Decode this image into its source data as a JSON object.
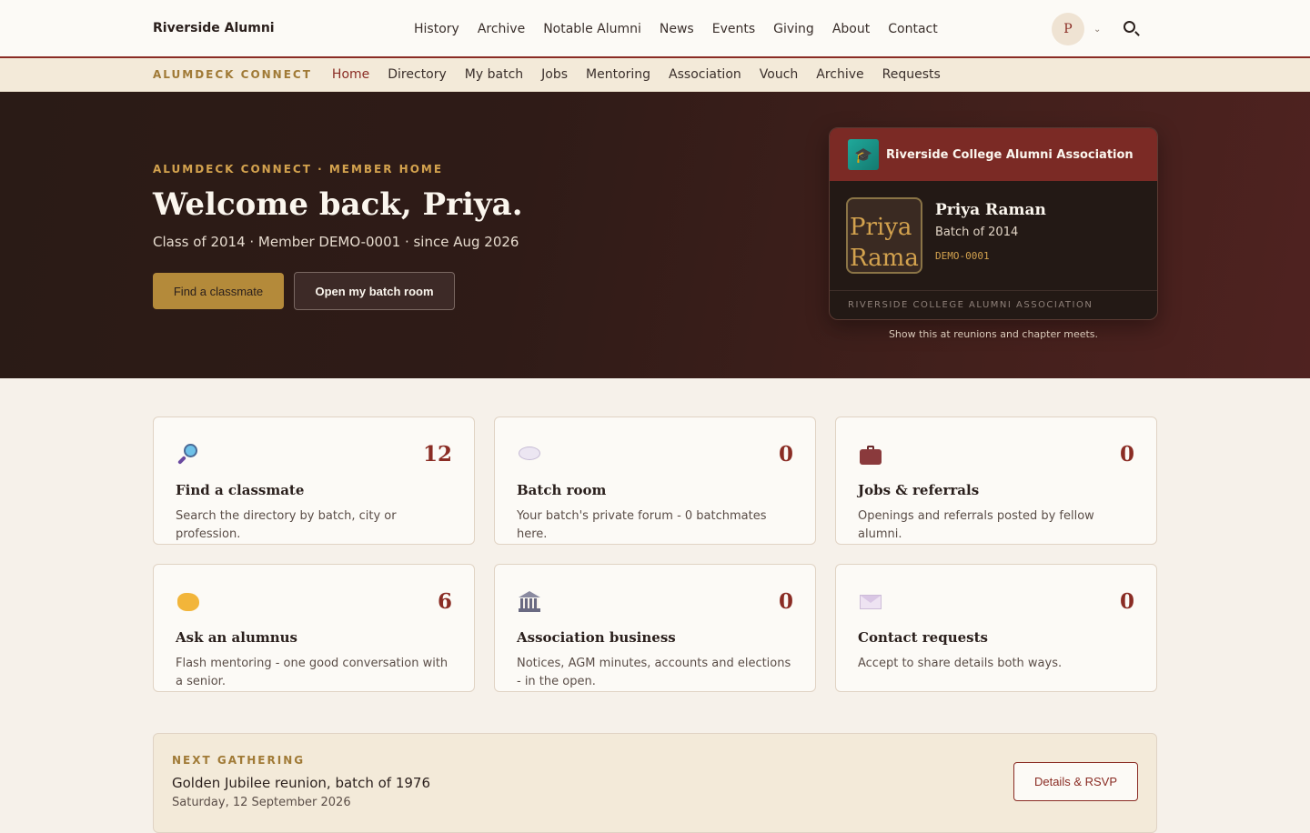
{
  "header": {
    "brand": "Riverside Alumni",
    "nav": [
      "History",
      "Archive",
      "Notable Alumni",
      "News",
      "Events",
      "Giving",
      "About",
      "Contact"
    ],
    "avatar_initial": "P"
  },
  "subnav": {
    "label": "ALUMDECK CONNECT",
    "items": [
      "Home",
      "Directory",
      "My batch",
      "Jobs",
      "Mentoring",
      "Association",
      "Vouch",
      "Archive",
      "Requests"
    ],
    "active": "Home"
  },
  "hero": {
    "eyebrow": "ALUMDECK CONNECT · MEMBER HOME",
    "title": "Welcome back, Priya.",
    "meta": "Class of 2014 · Member DEMO-0001 · since Aug 2026",
    "primary_button": "Find a classmate",
    "secondary_button": "Open my batch room"
  },
  "member_card": {
    "org": "Riverside College Alumni Association",
    "photo_alt": "Priya Raman",
    "name": "Priya Raman",
    "batch": "Batch of 2014",
    "member_id": "DEMO-0001",
    "footer": "RIVERSIDE COLLEGE ALUMNI ASSOCIATION",
    "note": "Show this at reunions and chapter meets."
  },
  "tiles": [
    {
      "icon": "magnifier-icon",
      "count": "12",
      "title": "Find a classmate",
      "desc": "Search the directory by batch, city or profession."
    },
    {
      "icon": "speech-bubble-icon",
      "count": "0",
      "title": "Batch room",
      "desc": "Your batch's private forum - 0 batchmates here."
    },
    {
      "icon": "briefcase-icon",
      "count": "0",
      "title": "Jobs & referrals",
      "desc": "Openings and referrals posted by fellow alumni."
    },
    {
      "icon": "handshake-icon",
      "count": "6",
      "title": "Ask an alumnus",
      "desc": "Flash mentoring - one good conversation with a senior."
    },
    {
      "icon": "bank-icon",
      "count": "0",
      "title": "Association business",
      "desc": "Notices, AGM minutes, accounts and elections - in the open."
    },
    {
      "icon": "envelope-icon",
      "count": "0",
      "title": "Contact requests",
      "desc": "Accept to share details both ways."
    }
  ],
  "gathering": {
    "label": "NEXT GATHERING",
    "title": "Golden Jubilee reunion, batch of 1976",
    "date": "Saturday, 12 September 2026",
    "button": "Details & RSVP"
  },
  "colors": {
    "accent": "#8a2c24",
    "gold": "#b48a3a",
    "hero_dark": "#2a1b16"
  }
}
